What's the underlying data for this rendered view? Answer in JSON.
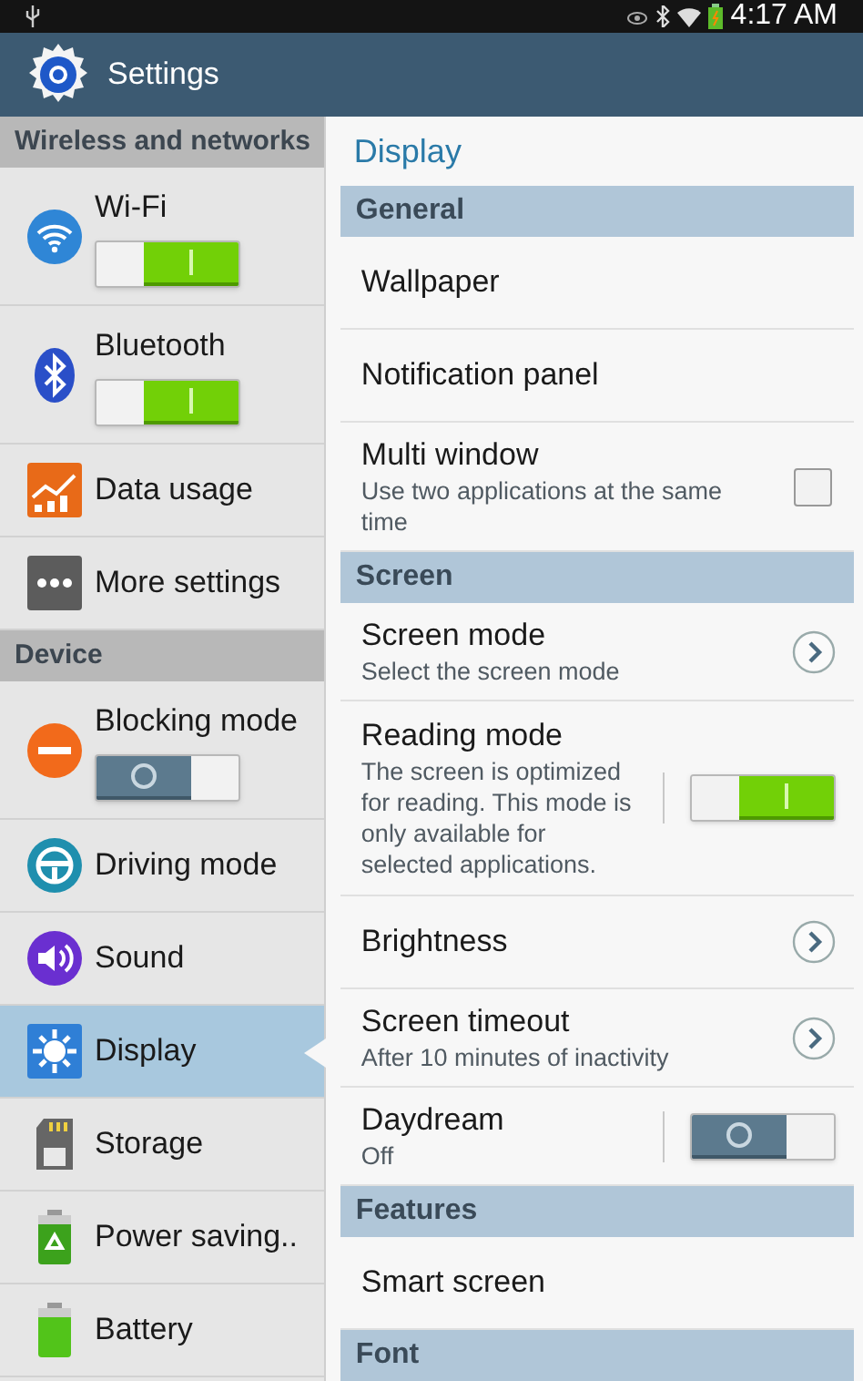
{
  "status_bar": {
    "time": "4:17 AM"
  },
  "action_bar": {
    "title": "Settings"
  },
  "sidebar": {
    "sections": [
      {
        "title": "Wireless and networks",
        "items": [
          {
            "label": "Wi-Fi",
            "kind": "toggle",
            "on": true,
            "selected": false
          },
          {
            "label": "Bluetooth",
            "kind": "toggle",
            "on": true,
            "selected": false
          },
          {
            "label": "Data usage",
            "kind": "plain",
            "selected": false
          },
          {
            "label": "More settings",
            "kind": "plain",
            "selected": false
          }
        ]
      },
      {
        "title": "Device",
        "items": [
          {
            "label": "Blocking mode",
            "kind": "toggle",
            "on": false,
            "selected": false
          },
          {
            "label": "Driving mode",
            "kind": "plain",
            "selected": false
          },
          {
            "label": "Sound",
            "kind": "plain",
            "selected": false
          },
          {
            "label": "Display",
            "kind": "plain",
            "selected": true
          },
          {
            "label": "Storage",
            "kind": "plain",
            "selected": false
          },
          {
            "label": "Power saving..",
            "kind": "plain",
            "selected": false
          },
          {
            "label": "Battery",
            "kind": "plain",
            "selected": false
          }
        ]
      }
    ]
  },
  "detail": {
    "title": "Display",
    "items": [
      {
        "kind": "header",
        "label": "General"
      },
      {
        "kind": "plain",
        "label": "Wallpaper"
      },
      {
        "kind": "plain",
        "label": "Notification panel"
      },
      {
        "kind": "checkbox",
        "label": "Multi window",
        "summary": "Use two applications at the same time",
        "checked": false
      },
      {
        "kind": "header",
        "label": "Screen"
      },
      {
        "kind": "arrow",
        "label": "Screen mode",
        "summary": "Select the screen mode"
      },
      {
        "kind": "toggle",
        "label": "Reading mode",
        "summary": "The screen is optimized for reading. This mode is only available for selected applications.",
        "on": true
      },
      {
        "kind": "arrow",
        "label": "Brightness"
      },
      {
        "kind": "arrow",
        "label": "Screen timeout",
        "summary": "After 10 minutes of inactivity"
      },
      {
        "kind": "toggle",
        "label": "Daydream",
        "summary": "Off",
        "on": false
      },
      {
        "kind": "header",
        "label": "Features"
      },
      {
        "kind": "plain",
        "label": "Smart screen"
      },
      {
        "kind": "header",
        "label": "Font"
      }
    ]
  }
}
